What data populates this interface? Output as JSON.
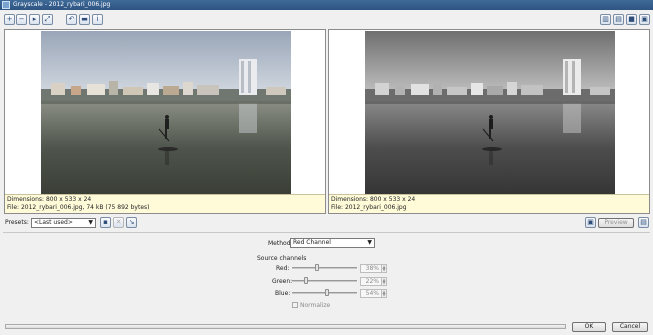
{
  "window": {
    "title": "Grayscale - 2012_rybari_006.jpg"
  },
  "toolbar_left": [
    {
      "name": "zoom-in-icon",
      "glyph": "+"
    },
    {
      "name": "zoom-out-icon",
      "glyph": "−"
    },
    {
      "name": "fit-window-icon",
      "glyph": "▸"
    },
    {
      "name": "full-size-icon",
      "glyph": "⤢"
    },
    {
      "name": "undo-icon",
      "glyph": "↶"
    },
    {
      "name": "folder-icon",
      "glyph": "▬"
    },
    {
      "name": "info-icon",
      "glyph": "i"
    }
  ],
  "toolbar_right": [
    {
      "name": "split-vertical-icon",
      "glyph": "▥"
    },
    {
      "name": "split-horizontal-icon",
      "glyph": "▤"
    },
    {
      "name": "single-view-icon",
      "glyph": "■"
    },
    {
      "name": "photo-view-icon",
      "glyph": "▣"
    }
  ],
  "original": {
    "dimensions": "Dimensions: 800 x 533 x 24",
    "file": "File: 2012_rybari_006.jpg, 74 kB (75 892 bytes)"
  },
  "preview": {
    "dimensions": "Dimensions: 800 x 533 x 24",
    "file": "File: 2012_rybari_006.jpg"
  },
  "presets": {
    "label": "Presets:",
    "value": "<Last used>"
  },
  "preview_button": "Preview",
  "method": {
    "label": "Method:",
    "value": "Red Channel"
  },
  "source": {
    "title": "Source channels",
    "red": {
      "label": "Red:",
      "value": "38%",
      "level": 0.38
    },
    "green": {
      "label": "Green:",
      "value": "22%",
      "level": 0.22
    },
    "blue": {
      "label": "Blue:",
      "value": "54%",
      "level": 0.54
    },
    "normalize": "Normalize"
  },
  "buttons": {
    "ok": "OK",
    "cancel": "Cancel"
  }
}
